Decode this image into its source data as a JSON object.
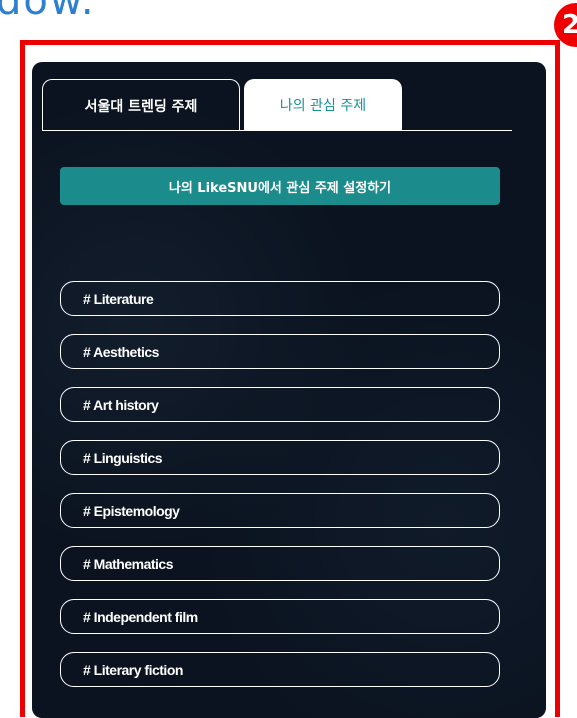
{
  "caption": "dow.",
  "marker_label": "2",
  "tabs": [
    {
      "label": "서울대 트렌딩 주제",
      "active": false
    },
    {
      "label": "나의 관심 주제",
      "active": true
    }
  ],
  "settings_button_label": "나의 LikeSNU에서 관심 주제 설정하기",
  "topics": [
    "# Literature",
    "# Aesthetics",
    "# Art history",
    "# Linguistics",
    "# Epistemology",
    "# Mathematics",
    "# Independent film",
    "# Literary fiction"
  ],
  "colors": {
    "panel_bg": "#0b1320",
    "accent": "#1c8b8b",
    "highlight": "#ee0000",
    "caption": "#2f7fd0"
  }
}
